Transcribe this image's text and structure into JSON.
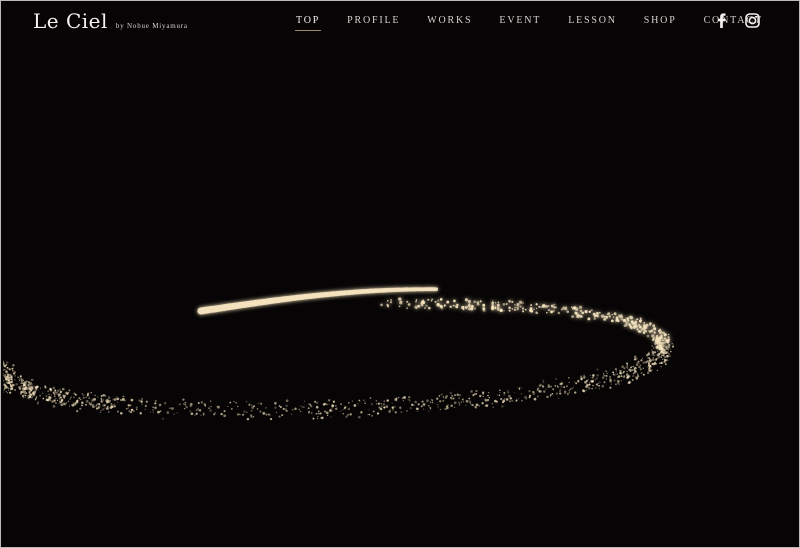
{
  "brand": {
    "name": "Le Ciel",
    "byline": "by Nobue Miyamura"
  },
  "nav": {
    "items": [
      {
        "label": "TOP",
        "active": true
      },
      {
        "label": "PROFILE",
        "active": false
      },
      {
        "label": "WORKS",
        "active": false
      },
      {
        "label": "EVENT",
        "active": false
      },
      {
        "label": "LESSON",
        "active": false
      },
      {
        "label": "SHOP",
        "active": false
      },
      {
        "label": "CONTACT",
        "active": false
      }
    ]
  },
  "social": {
    "facebook": {
      "icon": "facebook-icon"
    },
    "instagram": {
      "icon": "instagram-icon"
    }
  },
  "colors": {
    "background": "#060404",
    "text": "#f4f2ee",
    "accent": "#9b8a66",
    "sparkle": "#f3e2bd"
  }
}
